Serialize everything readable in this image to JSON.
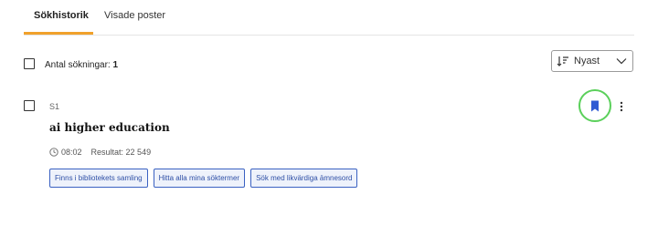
{
  "tabs": [
    {
      "label": "Sökhistorik",
      "active": true
    },
    {
      "label": "Visade poster",
      "active": false
    }
  ],
  "summary": {
    "label": "Antal sökningar:",
    "count": "1"
  },
  "sort": {
    "label": "Nyast",
    "icon": "sort-icon"
  },
  "history_item": {
    "index": "S1",
    "query": "ai higher education",
    "time": "08:02",
    "results": "Resultat: 22 549",
    "chips": [
      "Finns i bibliotekets samling",
      "Hitta alla mina söktermer",
      "Sök med likvärdiga ämnesord"
    ]
  },
  "colors": {
    "accent_tab": "#f0a12b",
    "chip_border": "#3a61c2",
    "bookmark": "#2f5bd3",
    "highlight_ring": "#5bd05b"
  }
}
